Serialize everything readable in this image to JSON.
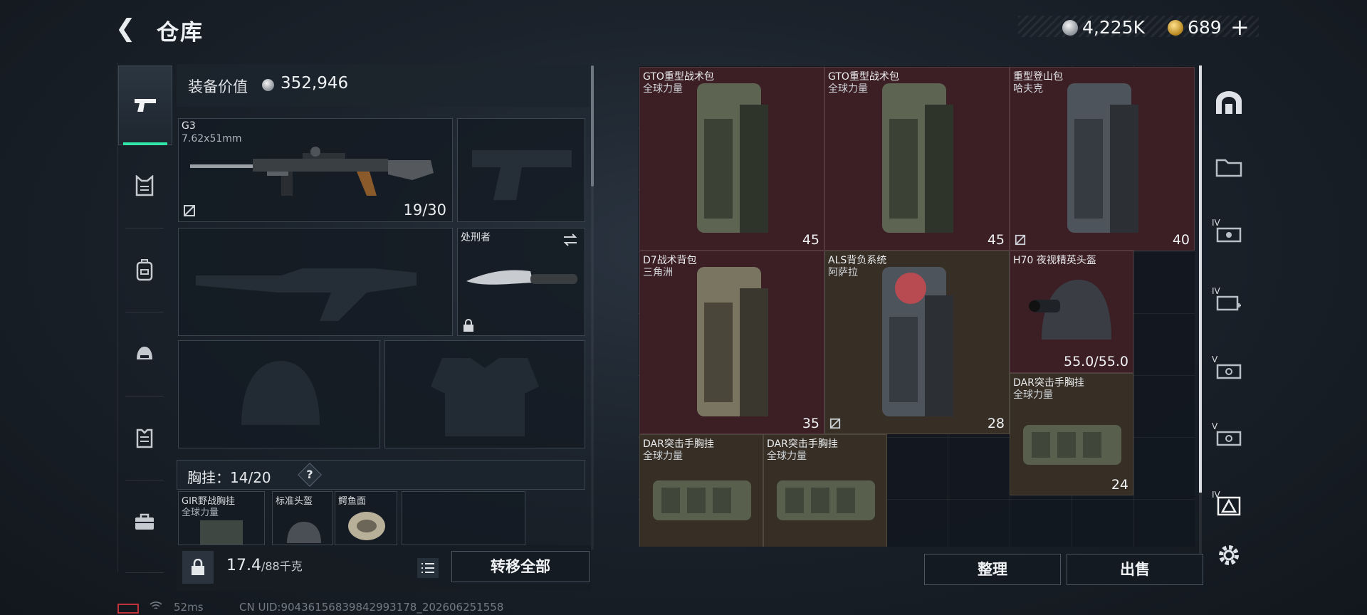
{
  "header": {
    "back_glyph": "❮",
    "title": "仓库",
    "currency_silver": "4,225K",
    "currency_gold": "689",
    "add_glyph": "+"
  },
  "equipment": {
    "value_label": "装备价值",
    "value": "352,946",
    "primary_weapon": {
      "name": "G3",
      "caliber": "7.62x51mm",
      "ammo": "19/30"
    },
    "melee": {
      "name": "处刑者"
    },
    "chest_label": "胸挂：",
    "chest_capacity": "14/20",
    "chest_help": "?",
    "pockets": [
      {
        "name": "GIR野战胸挂",
        "sub": "全球力量"
      },
      {
        "name": "标准头盔",
        "sub": ""
      },
      {
        "name": "鳄鱼面",
        "sub": ""
      }
    ],
    "weight_current": "17.4",
    "weight_max": "/88千克",
    "transfer_all": "转移全部"
  },
  "storage": {
    "items": [
      {
        "name": "GTO重型战术包",
        "sub": "全球力量",
        "count": "45"
      },
      {
        "name": "GTO重型战术包",
        "sub": "全球力量",
        "count": "45"
      },
      {
        "name": "重型登山包",
        "sub": "哈夫克",
        "count": "40"
      },
      {
        "name": "D7战术背包",
        "sub": "三角洲",
        "count": "35"
      },
      {
        "name": "ALS背负系统",
        "sub": "阿萨拉",
        "count": "28"
      },
      {
        "name": "H70 夜视精英头盔",
        "sub": "",
        "durability": "55.0/55.0"
      },
      {
        "name": "DAR突击手胸挂",
        "sub": "全球力量",
        "count": "24"
      },
      {
        "name": "DAR突击手胸挂",
        "sub": "全球力量"
      },
      {
        "name": "DAR突击手胸挂",
        "sub": "全球力量"
      }
    ],
    "sort_button": "整理",
    "sell_button": "出售"
  },
  "right_nav": {
    "tags": [
      "IV",
      "IV",
      "V",
      "V",
      "IV"
    ]
  },
  "status": {
    "ping": "52ms",
    "uid": "CN UID:9043615683984299317​8_202606251558"
  },
  "colors": {
    "accent": "#2ee5a8",
    "rare_red": "#3c1e25",
    "tan": "#372f25"
  }
}
